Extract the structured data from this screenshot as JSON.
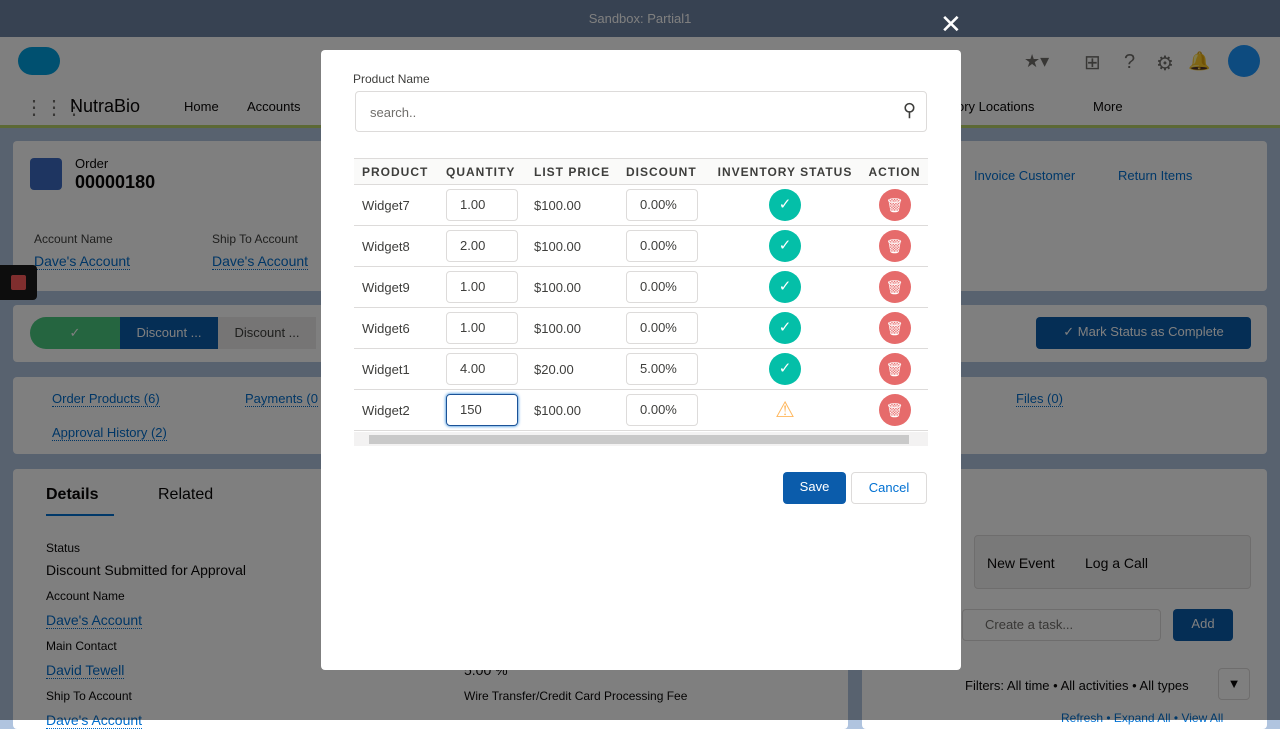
{
  "window": {
    "title": "Sandbox: Partial1"
  },
  "nav": {
    "app": "NutraBio",
    "items": [
      "Home",
      "Accounts",
      "ory Locations",
      "More"
    ]
  },
  "record": {
    "type": "Order",
    "number": "00000180",
    "account_label": "Account Name",
    "account": "Dave's Account",
    "ship_label": "Ship To Account",
    "ship": "Dave's Account",
    "actions": [
      "Invoice Customer",
      "Return Items"
    ]
  },
  "path": {
    "steps": [
      "Discount ...",
      "Discount ..."
    ],
    "complete_label": "Mark Status as Complete"
  },
  "related": {
    "links": [
      "Order Products (6)",
      "Payments (0",
      "Files (0)",
      "Approval History (2)"
    ]
  },
  "details": {
    "tabs": [
      "Details",
      "Related"
    ],
    "fields": [
      {
        "label": "Status",
        "value": "Discount Submitted for Approval"
      },
      {
        "label": "Account Name",
        "value": "Dave's Account"
      },
      {
        "label": "Main Contact",
        "value": "David Tewell"
      },
      {
        "label": "Ship To Account",
        "value": "Dave's Account"
      }
    ],
    "right_value1": "5.00 %",
    "right_value2": "Wire Transfer/Credit Card Processing Fee"
  },
  "activity": {
    "tabs": [
      "New Event",
      "Log a Call"
    ],
    "task_placeholder": "Create a task...",
    "add": "Add",
    "filters": "Filters: All time • All activities • All types",
    "footer": "Refresh • Expand All • View All"
  },
  "modal": {
    "search_label": "Product Name",
    "search_placeholder": "search..",
    "columns": [
      "PRODUCT",
      "QUANTITY",
      "LIST PRICE",
      "DISCOUNT",
      "INVENTORY STATUS",
      "ACTION"
    ],
    "rows": [
      {
        "product": "Widget7",
        "quantity": "1.00",
        "price": "$100.00",
        "discount": "0.00%",
        "status": "ok"
      },
      {
        "product": "Widget8",
        "quantity": "2.00",
        "price": "$100.00",
        "discount": "0.00%",
        "status": "ok"
      },
      {
        "product": "Widget9",
        "quantity": "1.00",
        "price": "$100.00",
        "discount": "0.00%",
        "status": "ok"
      },
      {
        "product": "Widget6",
        "quantity": "1.00",
        "price": "$100.00",
        "discount": "0.00%",
        "status": "ok"
      },
      {
        "product": "Widget1",
        "quantity": "4.00",
        "price": "$20.00",
        "discount": "5.00%",
        "status": "ok"
      },
      {
        "product": "Widget2",
        "quantity": "150",
        "price": "$100.00",
        "discount": "0.00%",
        "status": "warning"
      }
    ],
    "save": "Save",
    "cancel": "Cancel"
  },
  "colors": {
    "brand": "#0070d2",
    "success": "#04bfa8",
    "delete": "#e66b6b",
    "warning": "#ffb75d",
    "path_complete": "#4bca81",
    "path_current": "#0b5cab"
  }
}
